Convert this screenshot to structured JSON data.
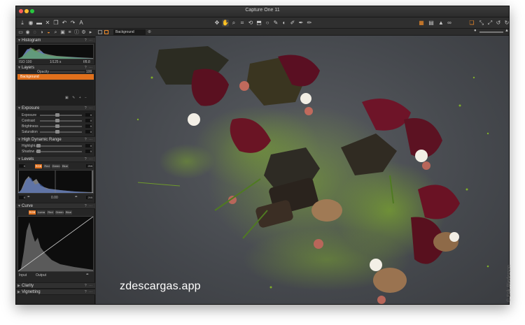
{
  "window": {
    "title": "Capture One 11"
  },
  "viewer": {
    "variant_name": "Background"
  },
  "sidebar": {
    "histogram": {
      "title": "Histogram",
      "info": [
        "ISO 100",
        "1/125 s",
        "f/8.8"
      ]
    },
    "layers": {
      "title": "Layers",
      "opacity_label": "Opacity",
      "opacity_value": "100",
      "layer_name": "Background"
    },
    "exposure": {
      "title": "Exposure",
      "rows": [
        "Exposure",
        "Contrast",
        "Brightness",
        "Saturation"
      ],
      "values": [
        "0",
        "0",
        "0",
        "0"
      ]
    },
    "hdr": {
      "title": "High Dynamic Range",
      "rows": [
        "Highlight",
        "Shadow"
      ],
      "values": [
        "0",
        "0"
      ]
    },
    "levels": {
      "title": "Levels",
      "low": "0",
      "high": "255",
      "mid": "0.00",
      "channels": [
        "RGB",
        "Red",
        "Green",
        "Blue"
      ]
    },
    "curve": {
      "title": "Curve",
      "channels": [
        "RGB",
        "Luma",
        "Red",
        "Green",
        "Blue"
      ],
      "input_label": "Input",
      "output_label": "Output"
    },
    "clarity": {
      "title": "Clarity"
    },
    "vignetting": {
      "title": "Vignetting"
    }
  },
  "watermark": "zdescargas.app",
  "credit": "© Erik Riederson",
  "colors": {
    "accent": "#e0701c",
    "panel": "#262626",
    "viewer_bg": "#4a4d52",
    "matcha": "#7fae2a"
  }
}
